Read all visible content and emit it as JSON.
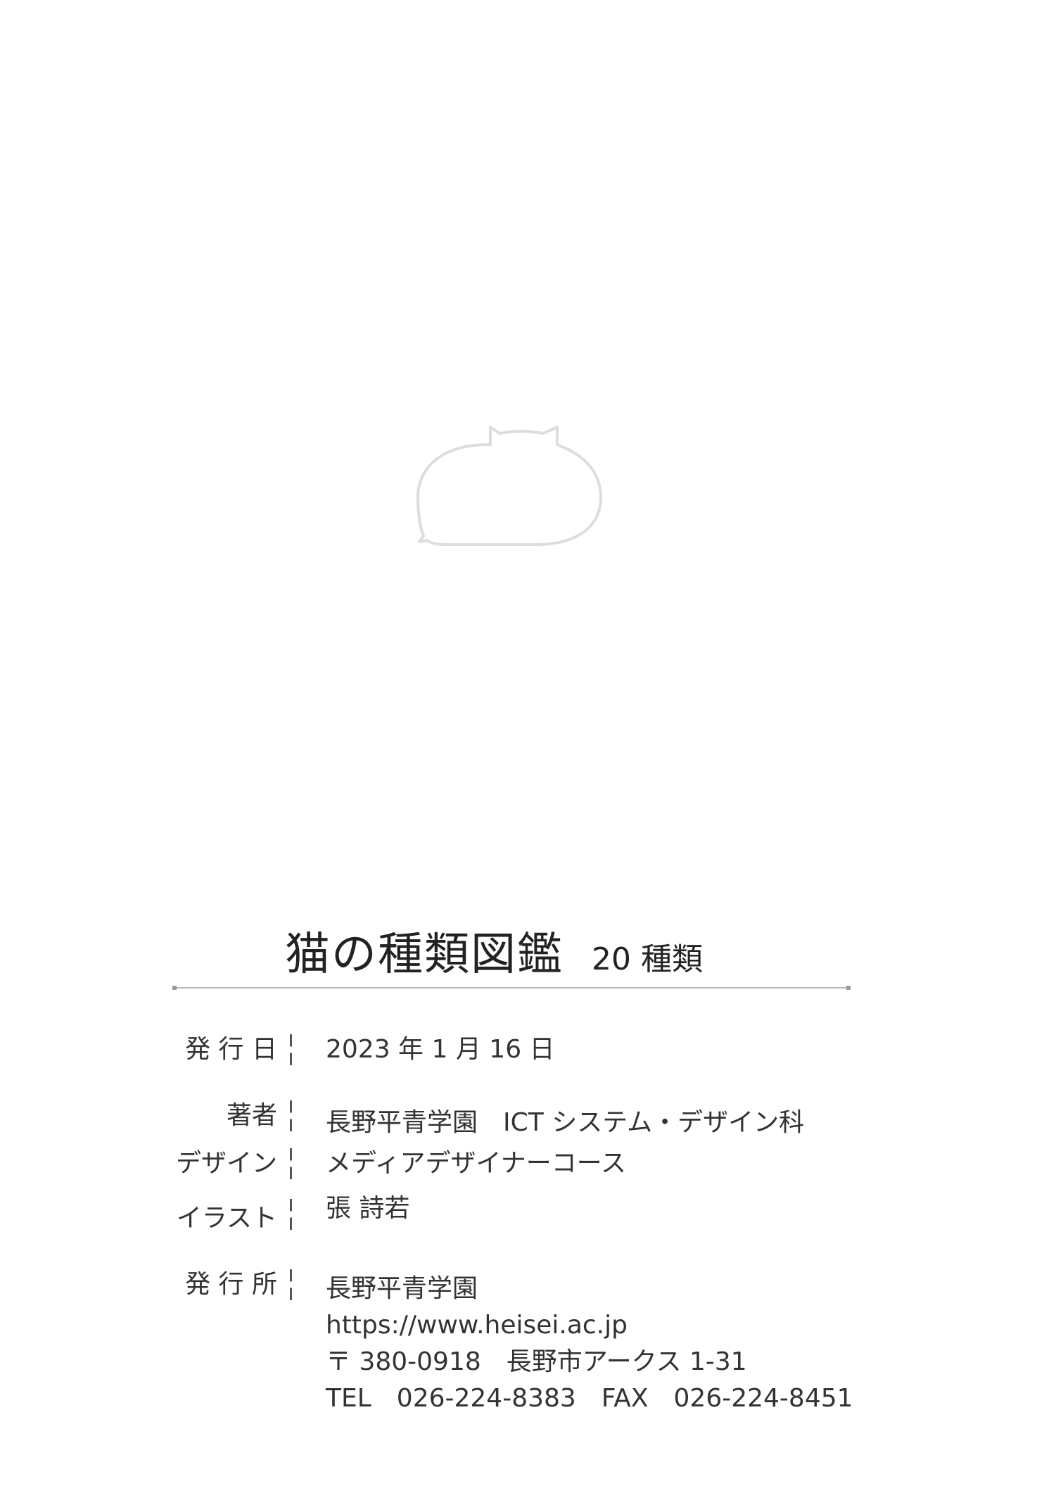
{
  "title": {
    "main": "猫の種類図鑑",
    "sub": "20 種類"
  },
  "colophon": {
    "publish_date": {
      "label": "発 行 日",
      "value": "2023 年 1 月 16 日"
    },
    "author": {
      "label": "著者",
      "value": "長野平青学園　ICT システム・デザイン科"
    },
    "design": {
      "label": "デザイン",
      "value": "メディアデザイナーコース"
    },
    "illustration": {
      "label": "イラスト",
      "value": "張 詩若"
    },
    "publisher": {
      "label": "発 行 所",
      "name": "長野平青学園",
      "url": "https://www.heisei.ac.jp",
      "address": "〒 380-0918　長野市アークス 1-31",
      "contact": "TEL　026-224-8383　FAX　026-224-8451"
    }
  },
  "colors": {
    "text": "#2a2a2a",
    "rule": "#bbbbbb",
    "logo_outline": "#dddddd"
  },
  "icons": {
    "logo": "cat-silhouette-icon"
  }
}
